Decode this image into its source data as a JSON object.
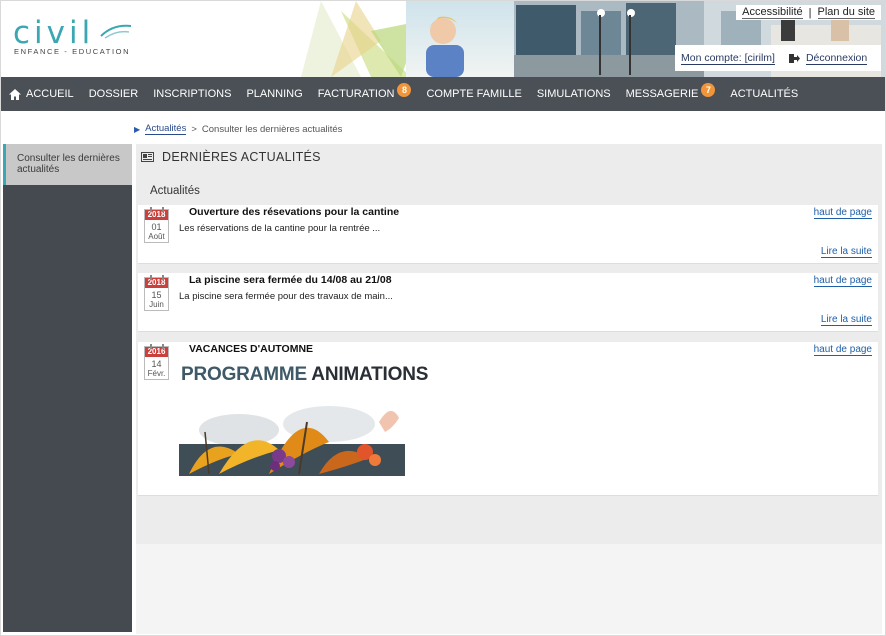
{
  "header": {
    "logo_word": "civil",
    "logo_subtitle": "ENFANCE - EDUCATION",
    "accessibility_link": "Accessibilité",
    "separator": "|",
    "sitemap_link": "Plan du site",
    "account_link": "Mon compte: [cirilm]",
    "logout_link": "Déconnexion"
  },
  "nav": {
    "items": [
      {
        "label": "Accueil",
        "icon": "home-icon"
      },
      {
        "label": "Dossier"
      },
      {
        "label": "Inscriptions"
      },
      {
        "label": "Planning"
      },
      {
        "label": "Facturation",
        "badge": "8"
      },
      {
        "label": "Compte famille"
      },
      {
        "label": "Simulations"
      },
      {
        "label": "Messagerie",
        "badge": "7"
      },
      {
        "label": "Actualités"
      }
    ],
    "badge_color": "#f0953a"
  },
  "breadcrumb": {
    "link": "Actualités",
    "separator": ">",
    "current": "Consulter les dernières actualités"
  },
  "sidebar": {
    "item_label": "Consulter les dernières actualités"
  },
  "main": {
    "section_title": "DERNIÈRES ACTUALITÉS",
    "sub_title": "Actualités",
    "news": [
      {
        "year": "2018",
        "day": "01",
        "month": "Août",
        "title": "Ouverture des résevations pour la cantine",
        "text": "Les réservations de la cantine pour la rentrée ...",
        "top_link": "haut de page",
        "more_link": "Lire la suite"
      },
      {
        "year": "2018",
        "day": "15",
        "month": "Juin",
        "title": "La piscine sera fermée du 14/08 au 21/08",
        "text": "La piscine sera fermée pour des travaux de main...",
        "top_link": "haut de page",
        "more_link": "Lire la suite"
      },
      {
        "year": "2016",
        "day": "14",
        "month": "Févr.",
        "title": "VACANCES D'AUTOMNE",
        "promo_word1": "PROGRAMME",
        "promo_word2": "ANIMATIONS",
        "top_link": "haut de page"
      }
    ]
  },
  "colors": {
    "accent_teal": "#3aa7b3",
    "nav_bg": "#4b5056",
    "sidebar_bg": "#454a50",
    "calendar_red": "#c9403c",
    "link_blue": "#1e5fa8"
  }
}
